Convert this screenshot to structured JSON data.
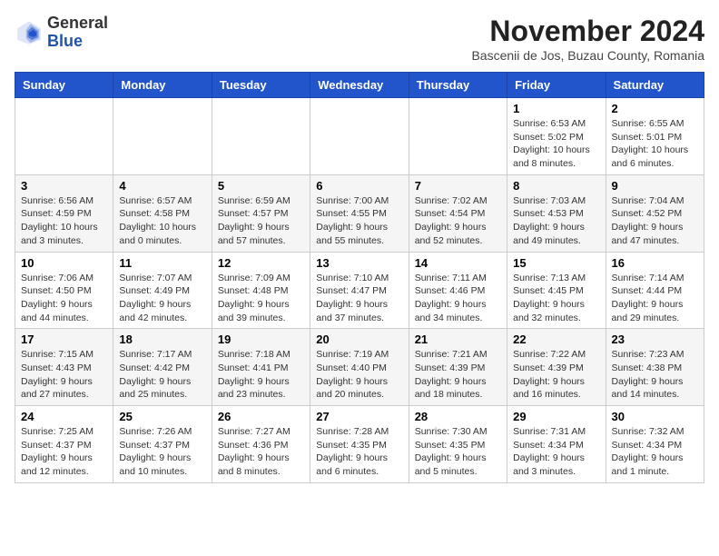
{
  "header": {
    "logo_general": "General",
    "logo_blue": "Blue",
    "month_year": "November 2024",
    "location": "Bascenii de Jos, Buzau County, Romania"
  },
  "days_of_week": [
    "Sunday",
    "Monday",
    "Tuesday",
    "Wednesday",
    "Thursday",
    "Friday",
    "Saturday"
  ],
  "weeks": [
    [
      {
        "day": "",
        "info": ""
      },
      {
        "day": "",
        "info": ""
      },
      {
        "day": "",
        "info": ""
      },
      {
        "day": "",
        "info": ""
      },
      {
        "day": "",
        "info": ""
      },
      {
        "day": "1",
        "info": "Sunrise: 6:53 AM\nSunset: 5:02 PM\nDaylight: 10 hours and 8 minutes."
      },
      {
        "day": "2",
        "info": "Sunrise: 6:55 AM\nSunset: 5:01 PM\nDaylight: 10 hours and 6 minutes."
      }
    ],
    [
      {
        "day": "3",
        "info": "Sunrise: 6:56 AM\nSunset: 4:59 PM\nDaylight: 10 hours and 3 minutes."
      },
      {
        "day": "4",
        "info": "Sunrise: 6:57 AM\nSunset: 4:58 PM\nDaylight: 10 hours and 0 minutes."
      },
      {
        "day": "5",
        "info": "Sunrise: 6:59 AM\nSunset: 4:57 PM\nDaylight: 9 hours and 57 minutes."
      },
      {
        "day": "6",
        "info": "Sunrise: 7:00 AM\nSunset: 4:55 PM\nDaylight: 9 hours and 55 minutes."
      },
      {
        "day": "7",
        "info": "Sunrise: 7:02 AM\nSunset: 4:54 PM\nDaylight: 9 hours and 52 minutes."
      },
      {
        "day": "8",
        "info": "Sunrise: 7:03 AM\nSunset: 4:53 PM\nDaylight: 9 hours and 49 minutes."
      },
      {
        "day": "9",
        "info": "Sunrise: 7:04 AM\nSunset: 4:52 PM\nDaylight: 9 hours and 47 minutes."
      }
    ],
    [
      {
        "day": "10",
        "info": "Sunrise: 7:06 AM\nSunset: 4:50 PM\nDaylight: 9 hours and 44 minutes."
      },
      {
        "day": "11",
        "info": "Sunrise: 7:07 AM\nSunset: 4:49 PM\nDaylight: 9 hours and 42 minutes."
      },
      {
        "day": "12",
        "info": "Sunrise: 7:09 AM\nSunset: 4:48 PM\nDaylight: 9 hours and 39 minutes."
      },
      {
        "day": "13",
        "info": "Sunrise: 7:10 AM\nSunset: 4:47 PM\nDaylight: 9 hours and 37 minutes."
      },
      {
        "day": "14",
        "info": "Sunrise: 7:11 AM\nSunset: 4:46 PM\nDaylight: 9 hours and 34 minutes."
      },
      {
        "day": "15",
        "info": "Sunrise: 7:13 AM\nSunset: 4:45 PM\nDaylight: 9 hours and 32 minutes."
      },
      {
        "day": "16",
        "info": "Sunrise: 7:14 AM\nSunset: 4:44 PM\nDaylight: 9 hours and 29 minutes."
      }
    ],
    [
      {
        "day": "17",
        "info": "Sunrise: 7:15 AM\nSunset: 4:43 PM\nDaylight: 9 hours and 27 minutes."
      },
      {
        "day": "18",
        "info": "Sunrise: 7:17 AM\nSunset: 4:42 PM\nDaylight: 9 hours and 25 minutes."
      },
      {
        "day": "19",
        "info": "Sunrise: 7:18 AM\nSunset: 4:41 PM\nDaylight: 9 hours and 23 minutes."
      },
      {
        "day": "20",
        "info": "Sunrise: 7:19 AM\nSunset: 4:40 PM\nDaylight: 9 hours and 20 minutes."
      },
      {
        "day": "21",
        "info": "Sunrise: 7:21 AM\nSunset: 4:39 PM\nDaylight: 9 hours and 18 minutes."
      },
      {
        "day": "22",
        "info": "Sunrise: 7:22 AM\nSunset: 4:39 PM\nDaylight: 9 hours and 16 minutes."
      },
      {
        "day": "23",
        "info": "Sunrise: 7:23 AM\nSunset: 4:38 PM\nDaylight: 9 hours and 14 minutes."
      }
    ],
    [
      {
        "day": "24",
        "info": "Sunrise: 7:25 AM\nSunset: 4:37 PM\nDaylight: 9 hours and 12 minutes."
      },
      {
        "day": "25",
        "info": "Sunrise: 7:26 AM\nSunset: 4:37 PM\nDaylight: 9 hours and 10 minutes."
      },
      {
        "day": "26",
        "info": "Sunrise: 7:27 AM\nSunset: 4:36 PM\nDaylight: 9 hours and 8 minutes."
      },
      {
        "day": "27",
        "info": "Sunrise: 7:28 AM\nSunset: 4:35 PM\nDaylight: 9 hours and 6 minutes."
      },
      {
        "day": "28",
        "info": "Sunrise: 7:30 AM\nSunset: 4:35 PM\nDaylight: 9 hours and 5 minutes."
      },
      {
        "day": "29",
        "info": "Sunrise: 7:31 AM\nSunset: 4:34 PM\nDaylight: 9 hours and 3 minutes."
      },
      {
        "day": "30",
        "info": "Sunrise: 7:32 AM\nSunset: 4:34 PM\nDaylight: 9 hours and 1 minute."
      }
    ]
  ]
}
